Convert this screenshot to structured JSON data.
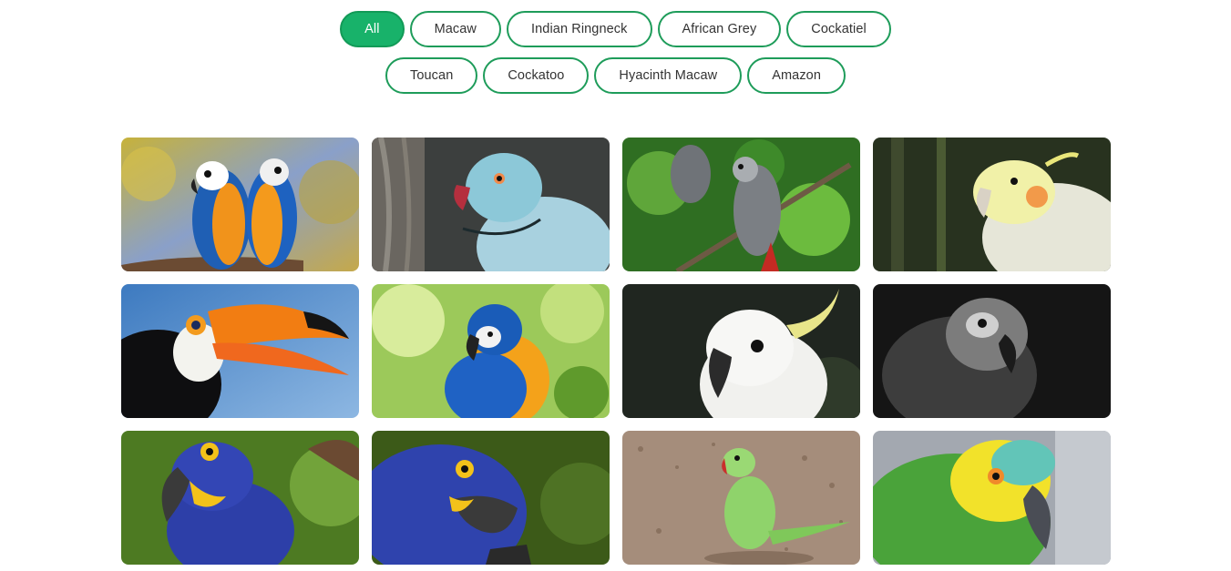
{
  "filters": {
    "row1": [
      "All",
      "Macaw",
      "Indian Ringneck",
      "African Grey",
      "Cockatiel"
    ],
    "row2": [
      "Toucan",
      "Cockatoo",
      "Hyacinth Macaw",
      "Amazon"
    ],
    "active": "All",
    "accent": "#18b26a",
    "border": "#1e9c5a"
  },
  "gallery": [
    {
      "subject": "macaw-pair-blue-gold"
    },
    {
      "subject": "indian-ringneck-blue"
    },
    {
      "subject": "african-grey-on-branch"
    },
    {
      "subject": "cockatiel-yellow"
    },
    {
      "subject": "toucan"
    },
    {
      "subject": "blue-gold-macaw"
    },
    {
      "subject": "cockatoo-white"
    },
    {
      "subject": "african-grey-dark"
    },
    {
      "subject": "hyacinth-macaw"
    },
    {
      "subject": "hyacinth-macaw-closeup"
    },
    {
      "subject": "indian-ringneck-green"
    },
    {
      "subject": "amazon-parrot"
    }
  ]
}
